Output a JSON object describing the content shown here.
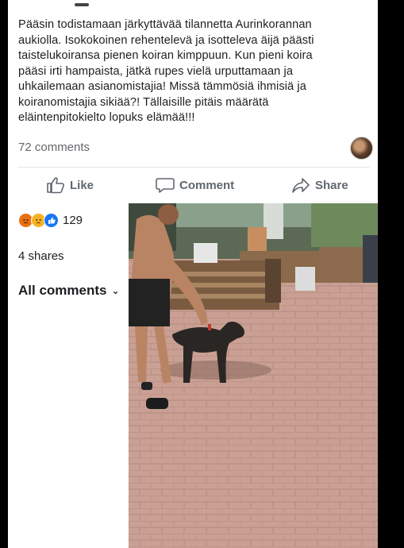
{
  "post": {
    "text": "Pääsin todistamaan järkyttävää tilannetta Aurinkorannan\naukiolla. Isokokoinen rehentelevä ja  isotteleva äijä päästi\ntaistelukoiransa pienen koiran kimppuun. Kun pieni koira\npääsi irti hampaista, jätkä rupes vielä urputtamaan ja\nuhkailemaan asianomistajia!  Missä tämmösiä ihmisiä ja\nkoiranomistajia sikiää?! Tällaisille pitäis määrätä\neläintenpitokielto lopuks elämää!!!",
    "comment_count": "72 comments"
  },
  "actions": {
    "like": "Like",
    "comment": "Comment",
    "share": "Share"
  },
  "reactions": {
    "icons": [
      "angry-icon",
      "sad-icon",
      "like-icon"
    ],
    "count": "129"
  },
  "shares": "4 shares",
  "comments_filter": "All comments",
  "colors": {
    "text": "#1c1e21",
    "muted": "#65676b",
    "action": "#606770",
    "accent": "#1877f2"
  }
}
